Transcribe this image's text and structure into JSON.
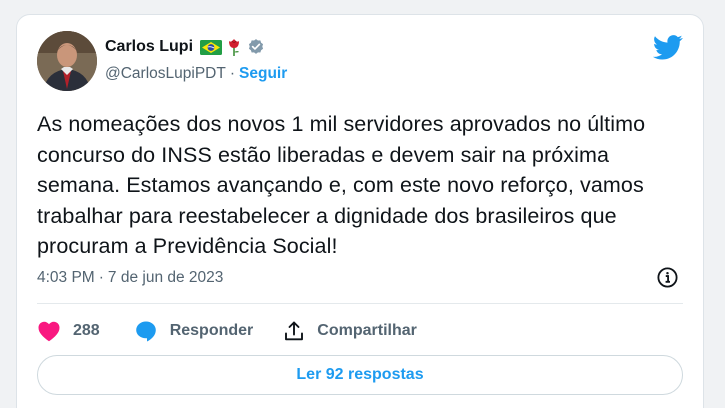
{
  "author": {
    "display_name": "Carlos Lupi",
    "handle": "@CarlosLupiPDT",
    "separator": "·",
    "follow_label": "Seguir",
    "badges": [
      "brazil-flag-emoji",
      "rose-emoji",
      "verified-badge"
    ]
  },
  "tweet": {
    "text": "As nomeações dos novos 1 mil servidores aprovados no último concurso do INSS estão liberadas e devem sair na próxima semana. Estamos avançando e, com este novo reforço, vamos trabalhar para reestabelecer a dignidade dos brasileiros que procuram a Previdência Social!",
    "time": "4:03 PM",
    "meta_separator": "·",
    "date": "7 de jun de 2023"
  },
  "actions": {
    "like_count": "288",
    "reply_label": "Responder",
    "share_label": "Compartilhar"
  },
  "replies_button": {
    "label": "Ler 92 respostas"
  },
  "colors": {
    "accent": "#1d9bf0",
    "like": "#f91880",
    "text": "#0f1419",
    "secondary": "#536471"
  },
  "icons": {
    "brand": "twitter-bird-icon",
    "info": "info-icon",
    "like": "heart-icon",
    "reply": "speech-bubble-icon",
    "share": "share-upload-icon"
  }
}
